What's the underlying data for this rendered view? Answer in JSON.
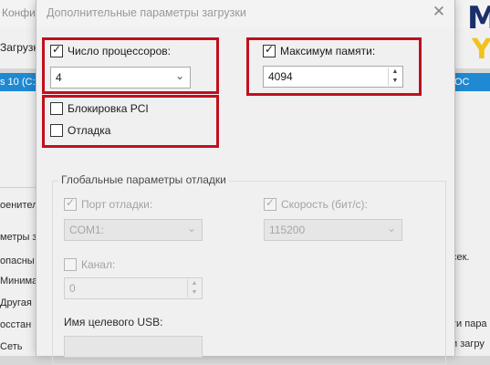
{
  "background": {
    "title": "Конфигурац",
    "tab_label": "Загрузк",
    "list_left": "s 10 (C:",
    "list_right": "ОС",
    "logo_m": "M",
    "logo_y": "Y",
    "left_texts": [
      "оенитель",
      "метры з",
      "опасны",
      "Минима",
      "Другая",
      "осстан",
      "Сеть"
    ],
    "right_texts": [
      "сек.",
      "ти пара",
      "и загру"
    ]
  },
  "dialog": {
    "title": "Дополнительные параметры загрузки",
    "close": "✕",
    "processors": {
      "label": "Число процессоров:",
      "checked": true,
      "value": "4"
    },
    "memory": {
      "label": "Максимум памяти:",
      "checked": true,
      "value": "4094"
    },
    "pci_lock": {
      "label": "Блокировка PCI",
      "checked": false
    },
    "debug": {
      "label": "Отладка",
      "checked": false
    },
    "global_debug": {
      "title": "Глобальные параметры отладки",
      "debug_port": {
        "label": "Порт отладки:",
        "checked": true,
        "value": "COM1:"
      },
      "baud_rate": {
        "label": "Скорость (бит/с):",
        "checked": true,
        "value": "115200"
      },
      "channel": {
        "label": "Канал:",
        "checked": false,
        "value": "0"
      },
      "usb_target": {
        "label": "Имя целевого USB:"
      }
    }
  },
  "colors": {
    "highlight_border": "#c0101e",
    "selection": "#1f8ad3"
  }
}
